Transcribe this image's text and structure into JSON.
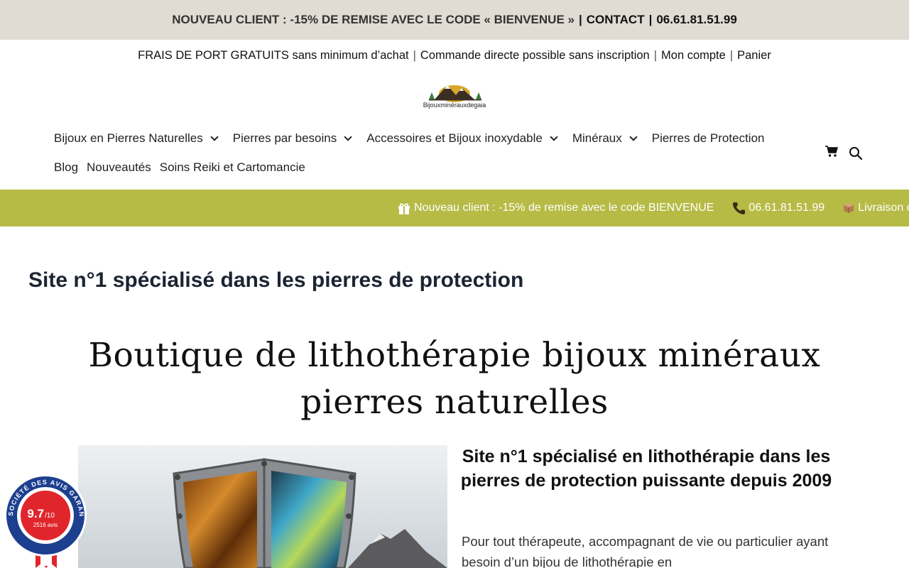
{
  "topbar": {
    "promo": "NOUVEAU CLIENT : -15% DE REMISE AVEC LE CODE « BIENVENUE »",
    "sep": "|",
    "contact": "CONTACT",
    "phone": "06.61.81.51.99"
  },
  "infobar": {
    "shipping": "FRAIS DE PORT GRATUITS sans minimum d’achat",
    "direct": "Commande directe possible sans inscription",
    "account": "Mon compte",
    "cart": "Panier",
    "sep": "|"
  },
  "logo": {
    "text": "Bijouxminérauxdegaia",
    "icon": "mountain-logo"
  },
  "nav": {
    "row1": [
      {
        "label": "Bijoux en Pierres Naturelles",
        "dropdown": true
      },
      {
        "label": "Pierres par besoins",
        "dropdown": true
      },
      {
        "label": "Accessoires et Bijoux inoxydable",
        "dropdown": true
      },
      {
        "label": "Minéraux",
        "dropdown": true
      },
      {
        "label": "Pierres de Protection",
        "dropdown": false
      }
    ],
    "row2": [
      {
        "label": "Blog"
      },
      {
        "label": "Nouveautés"
      },
      {
        "label": "Soins Reiki et Cartomancie"
      }
    ]
  },
  "ticker": {
    "bg": "#b6bb46",
    "promo": "Nouveau client : -15% de remise avec le code BIENVENUE",
    "phone": "06.61.81.51.99",
    "delivery": "Livraison offe"
  },
  "headline": "Site n°1 spécialisé dans les pierres de protection",
  "title_line1": "Boutique de lithothérapie bijoux minéraux",
  "title_line2": "pierres naturelles",
  "subtitle": "Site n°1 spécialisé en lithothérapie dans les pierres de protection puissante depuis 2009",
  "paragraph": "Pour tout thérapeute, accompagnant de vie ou particulier ayant besoin d’un bijou de lithothérapie en",
  "badge": {
    "brand": "SOCIÉTÉ DES AVIS GARANTIS",
    "score": "9.7",
    "scale": "/10",
    "count": "2516 avis"
  }
}
